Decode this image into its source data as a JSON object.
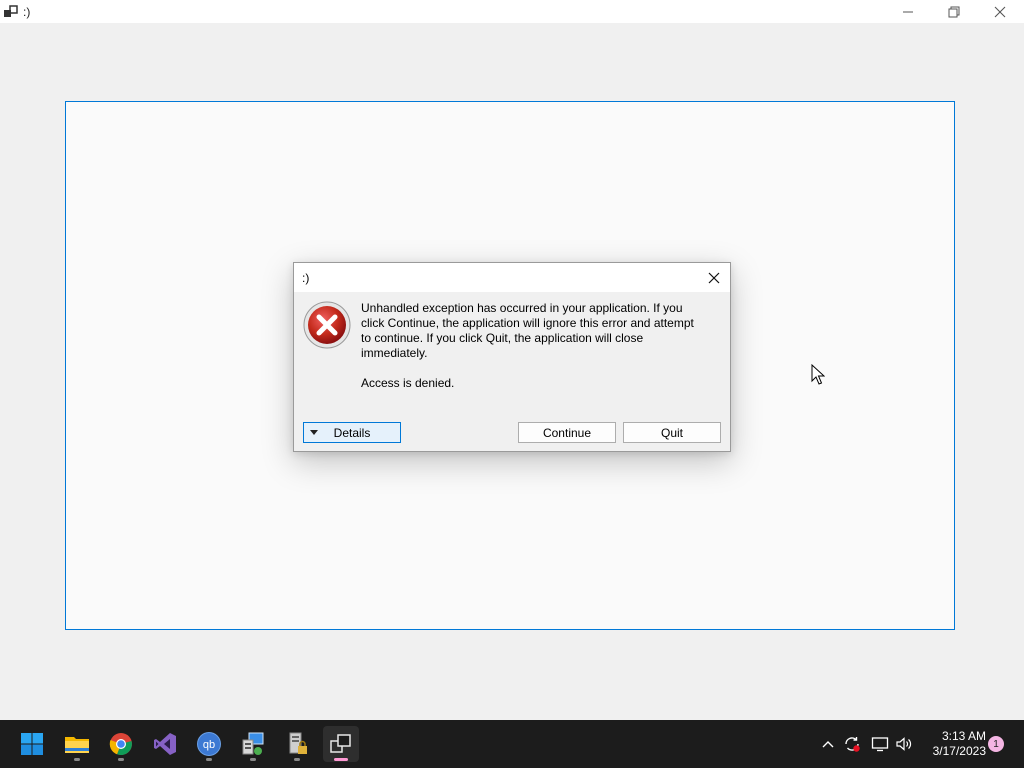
{
  "window": {
    "title": ":)",
    "icon": "app-window-icon",
    "controls": [
      "minimize-icon",
      "maximize-icon",
      "close-icon"
    ]
  },
  "dialog": {
    "title": ":)",
    "icon": "error-icon",
    "message_lines": [
      "Unhandled exception has occurred in your application. If you",
      "click Continue, the application will ignore this error and attempt",
      "to continue. If you click Quit, the application will close",
      "immediately."
    ],
    "detail": "Access is denied.",
    "buttons": {
      "details": "Details",
      "continue": "Continue",
      "quit": "Quit"
    },
    "accent_color": "#0078d7",
    "error_color": "#c42b1c"
  },
  "taskbar": {
    "apps": [
      {
        "name": "start",
        "icon": "windows-start-icon"
      },
      {
        "name": "file-explorer",
        "icon": "folder-icon"
      },
      {
        "name": "chrome",
        "icon": "chrome-icon"
      },
      {
        "name": "visual-studio",
        "icon": "visual-studio-icon"
      },
      {
        "name": "qbittorrent",
        "icon": "qbittorrent-icon"
      },
      {
        "name": "app-manager",
        "icon": "network-computer-icon"
      },
      {
        "name": "security-tool",
        "icon": "server-lock-icon"
      },
      {
        "name": "current-app",
        "icon": "app-window-icon",
        "active": true
      }
    ],
    "tray": [
      "chevron-up-icon",
      "sync-error-icon",
      "network-icon",
      "volume-icon"
    ],
    "time": "3:13 AM",
    "date": "3/17/2023",
    "notification_count": "1"
  }
}
